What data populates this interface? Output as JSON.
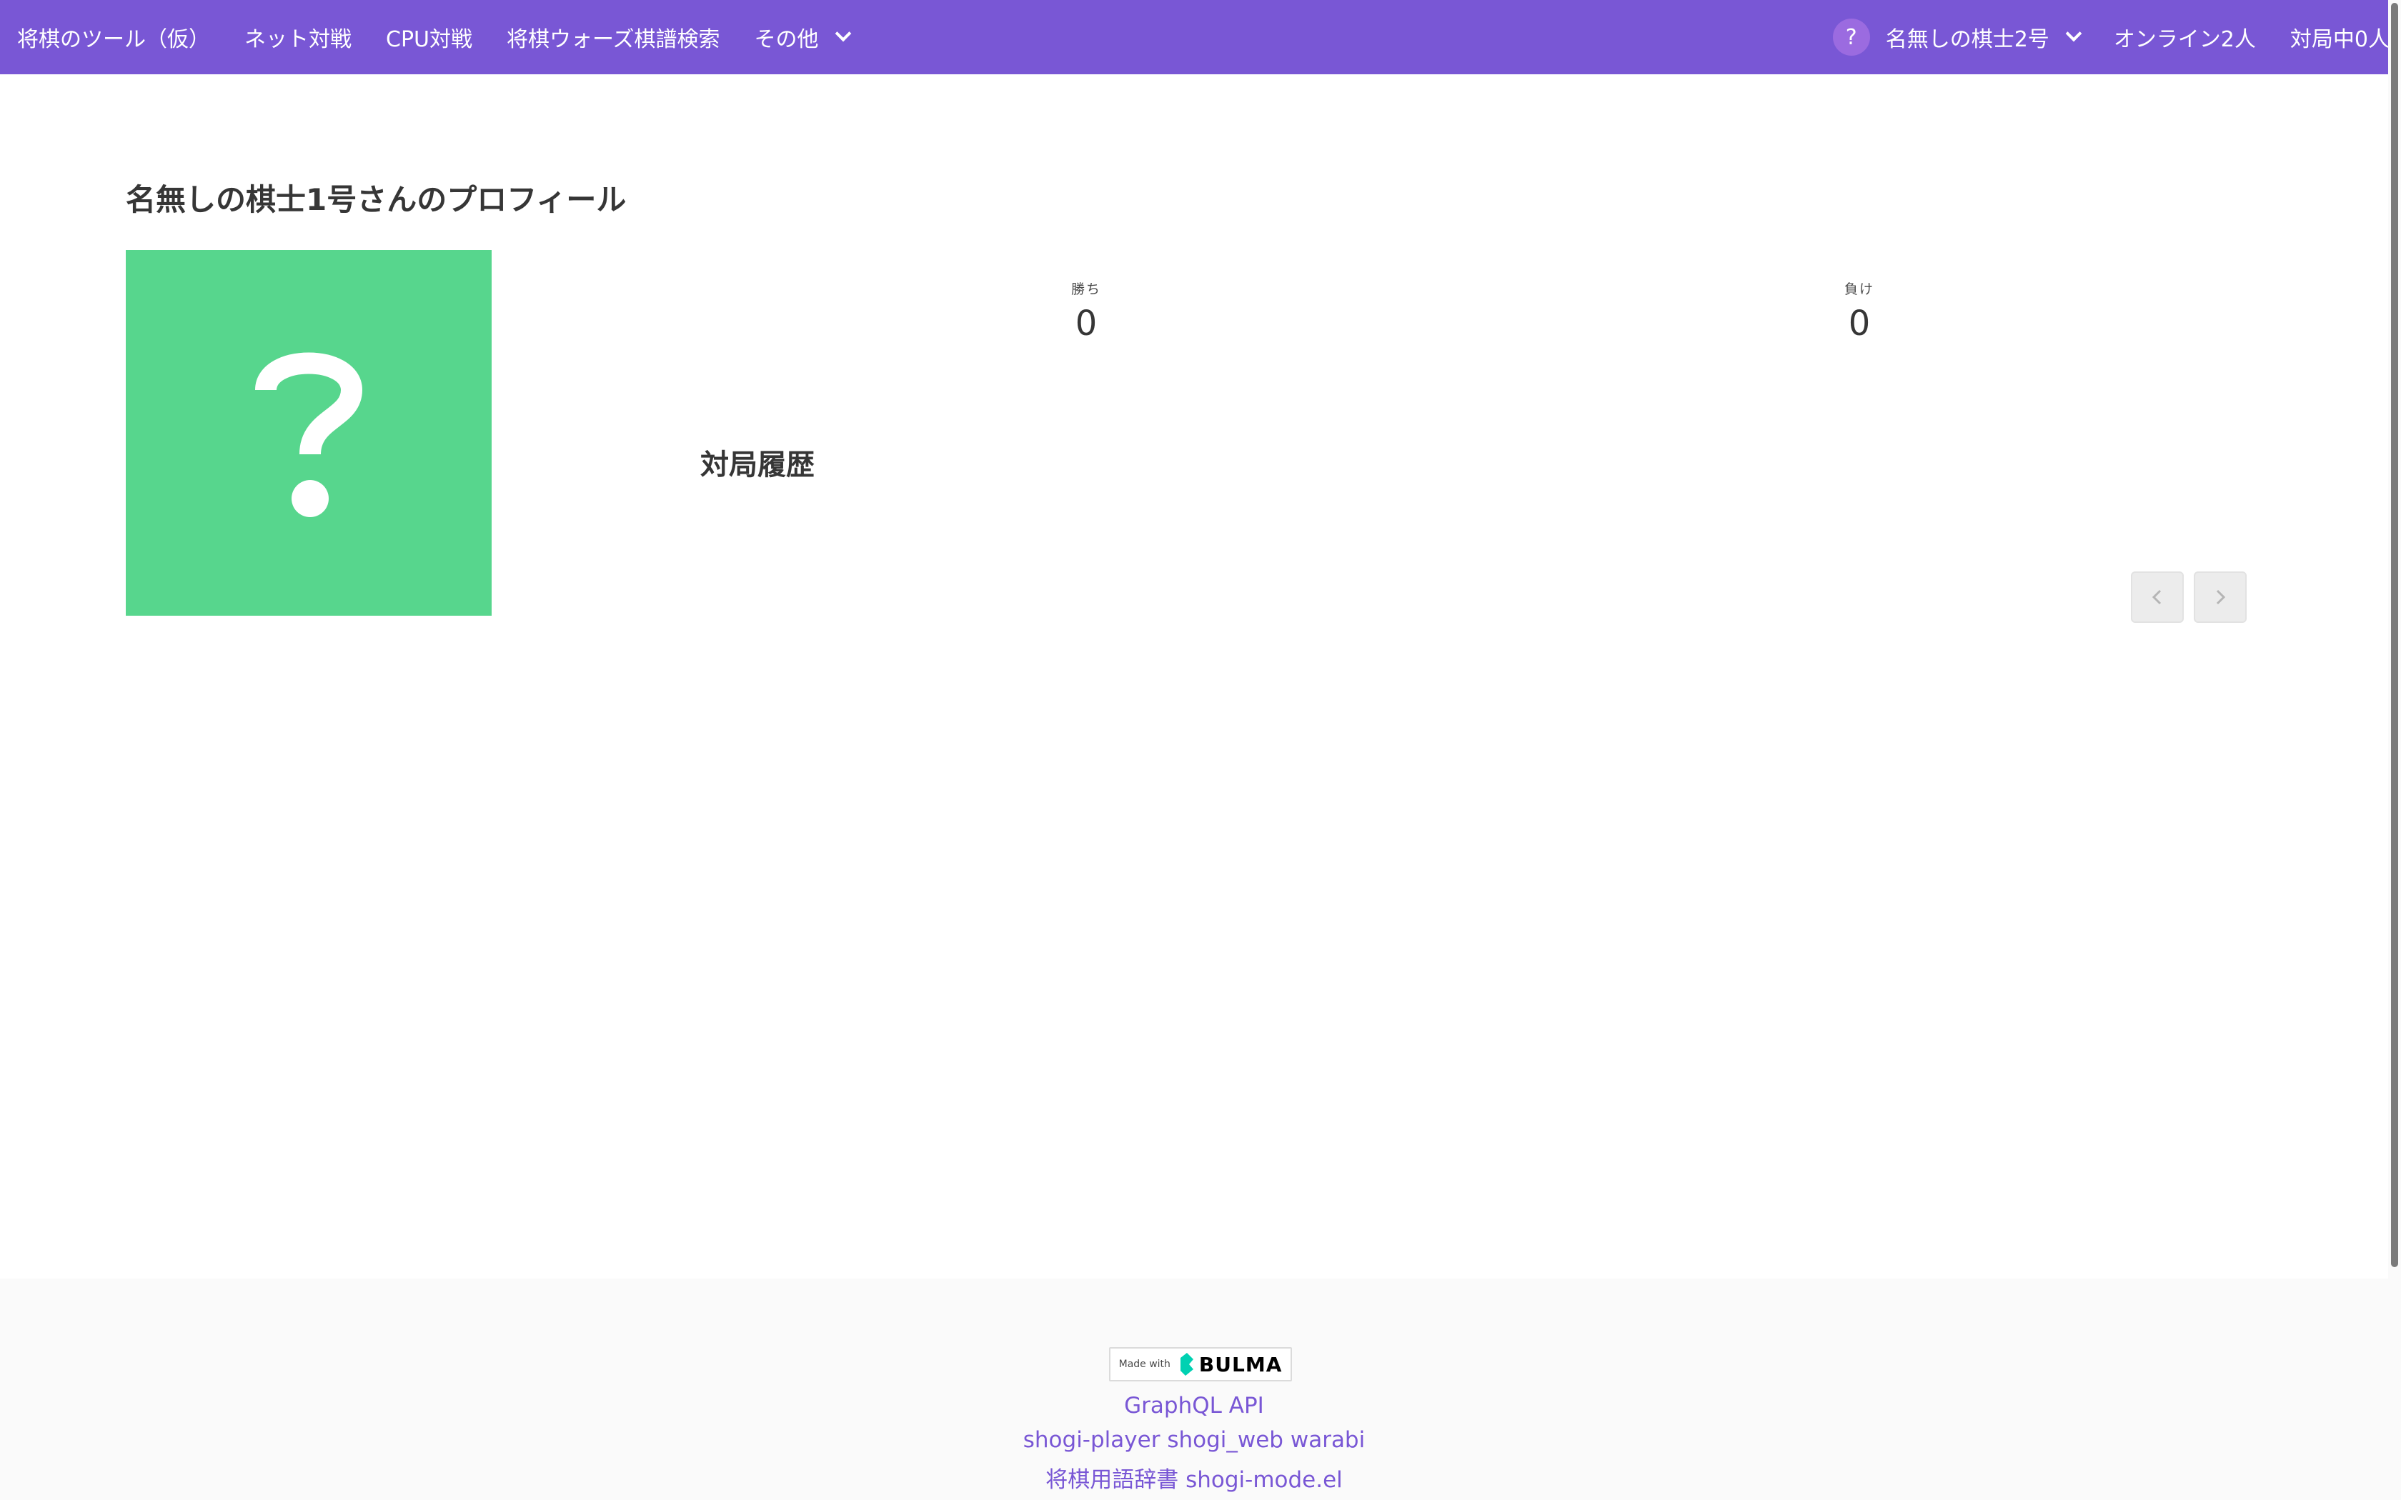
{
  "navbar": {
    "brand": "将棋のツール（仮）",
    "items": [
      "ネット対戦",
      "CPU対戦",
      "将棋ウォーズ棋譜検索"
    ],
    "more_label": "その他",
    "user_avatar_glyph": "?",
    "user_name": "名無しの棋士2号",
    "online": "オンライン2人",
    "playing": "対局中0人",
    "color": "#7957d5"
  },
  "profile": {
    "title": "名無しの棋士1号さんのプロフィール",
    "avatar_color": "#57d68d",
    "avatar_icon": "question-mark-icon",
    "stats": {
      "wins_label": "勝ち",
      "wins_value": "0",
      "losses_label": "負け",
      "losses_value": "0"
    },
    "history_title": "対局履歴"
  },
  "pagination": {
    "prev_icon": "chevron-left-icon",
    "next_icon": "chevron-right-icon"
  },
  "footer": {
    "badge_made_with": "Made with",
    "badge_brand": "BULMA",
    "links": {
      "graphql": "GraphQL API",
      "shogi_player": "shogi-player",
      "shogi_web": "shogi_web",
      "warabi": "warabi",
      "dictionary": "将棋用語辞書",
      "shogi_mode": "shogi-mode.el"
    }
  }
}
